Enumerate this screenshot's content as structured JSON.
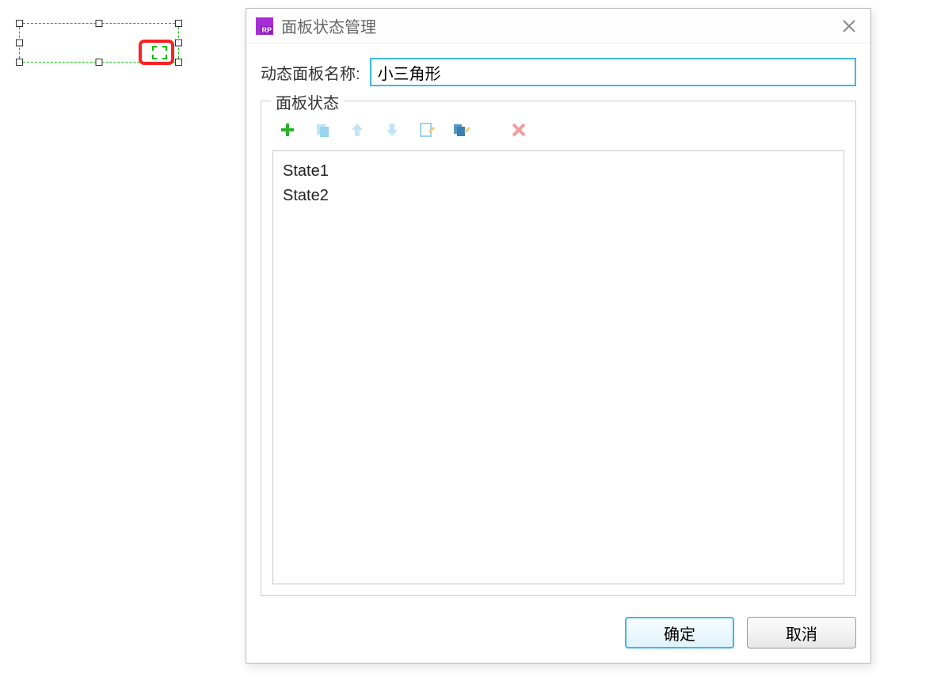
{
  "canvas": {
    "selection_type": "dynamic-panel"
  },
  "dialog": {
    "title": "面板状态管理",
    "app_icon_label": "RP",
    "name_label": "动态面板名称:",
    "name_value": "小三角形",
    "fieldset_legend": "面板状态",
    "toolbar": {
      "add": "add-state",
      "duplicate": "duplicate-state",
      "move_up": "move-up",
      "move_down": "move-down",
      "edit": "edit-state",
      "edit_all": "edit-all-states",
      "delete": "delete-state"
    },
    "states": [
      "State1",
      "State2"
    ],
    "ok_label": "确定",
    "cancel_label": "取消"
  }
}
